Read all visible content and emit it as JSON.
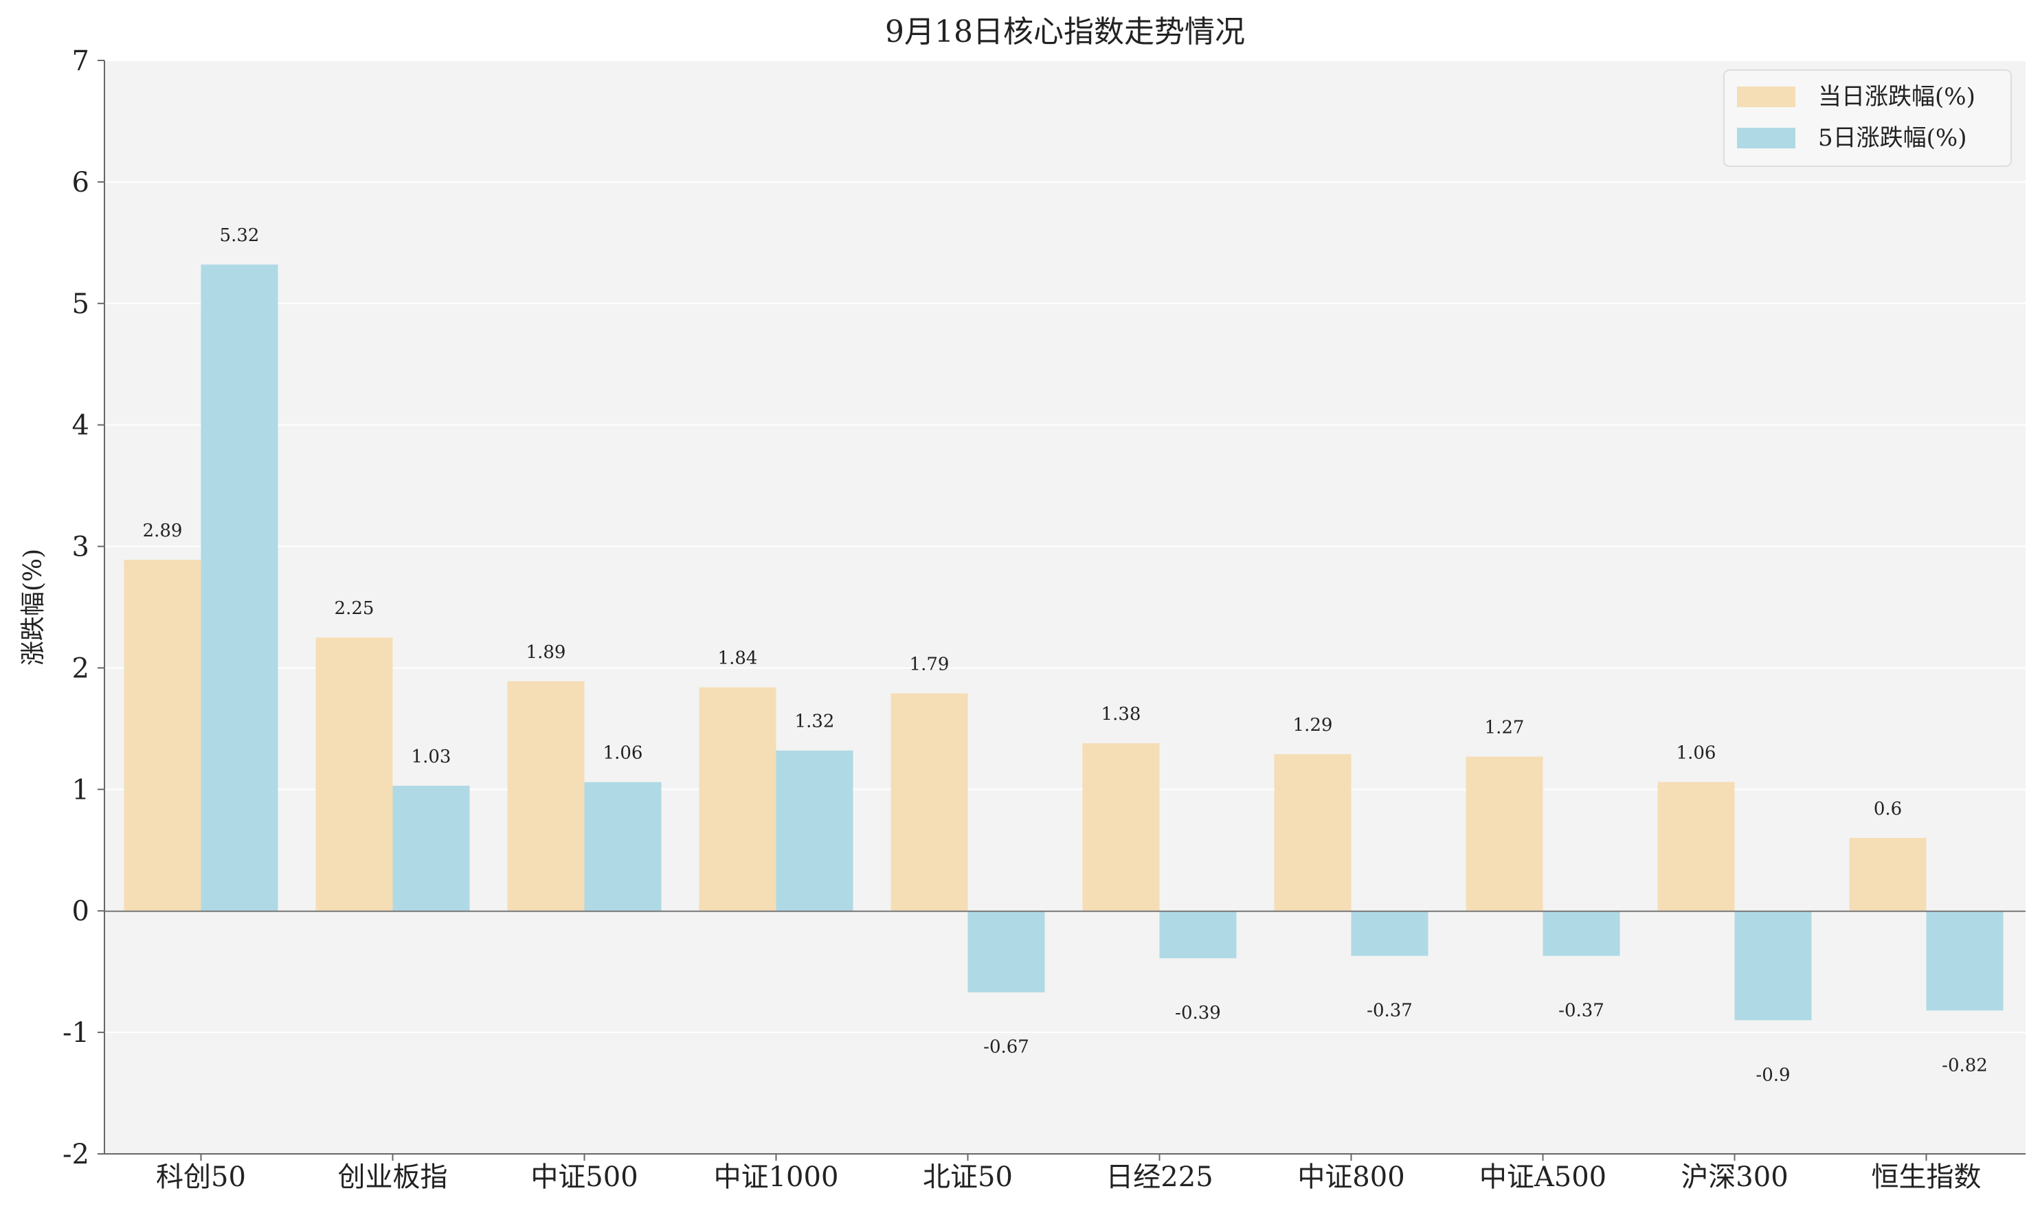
{
  "chart_data": {
    "type": "bar",
    "title": "9月18日核心指数走势情况",
    "xlabel": "",
    "ylabel": "涨跌幅(%)",
    "ylim": [
      -2,
      7
    ],
    "yticks": [
      -2,
      -1,
      0,
      1,
      2,
      3,
      4,
      5,
      6,
      7
    ],
    "grid": true,
    "legend_position": "top-right",
    "categories": [
      "科创50",
      "创业板指",
      "中证500",
      "中证1000",
      "北证50",
      "日经225",
      "中证800",
      "中证A500",
      "沪深300",
      "恒生指数"
    ],
    "series": [
      {
        "name": "当日涨跌幅(%)",
        "color": "#f5ddb5",
        "values": [
          2.89,
          2.25,
          1.89,
          1.84,
          1.79,
          1.38,
          1.29,
          1.27,
          1.06,
          0.6
        ],
        "labels": [
          "2.89",
          "2.25",
          "1.89",
          "1.84",
          "1.79",
          "1.38",
          "1.29",
          "1.27",
          "1.06",
          "0.6"
        ]
      },
      {
        "name": "5日涨跌幅(%)",
        "color": "#afd9e5",
        "values": [
          5.32,
          1.03,
          1.06,
          1.32,
          -0.67,
          -0.39,
          -0.37,
          -0.37,
          -0.9,
          -0.82
        ],
        "labels": [
          "5.32",
          "1.03",
          "1.06",
          "1.32",
          "-0.67",
          "-0.39",
          "-0.37",
          "-0.37",
          "-0.9",
          "-0.82"
        ]
      }
    ]
  }
}
